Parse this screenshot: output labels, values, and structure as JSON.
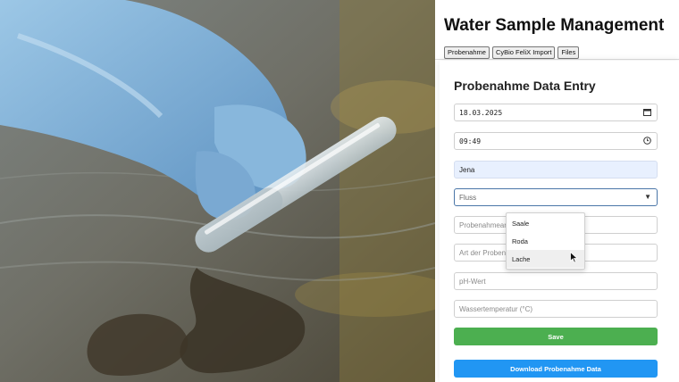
{
  "app": {
    "title": "Water Sample Management"
  },
  "tabs": [
    "Probenahme",
    "CyBio FeliX Import",
    "Files"
  ],
  "form": {
    "title": "Probenahme Data Entry",
    "date": {
      "value": "18.03.2025",
      "icon": "calendar-icon"
    },
    "time": {
      "value": "09:49",
      "icon": "clock-icon"
    },
    "location": {
      "value": "Jena"
    },
    "river": {
      "value": "Fluss",
      "icon": "caret-down-icon",
      "options": [
        "Saale",
        "Roda",
        "Lache"
      ],
      "hovered_option": "Lache"
    },
    "sampler": {
      "placeholder": "Probenahmear"
    },
    "sample_type": {
      "placeholder": "Art der Proben"
    },
    "ph": {
      "placeholder": "pH-Wert"
    },
    "water_temp": {
      "placeholder": "Wassertemperatur (°C)"
    },
    "save_label": "Save",
    "download_label": "Download Probenahme Data"
  },
  "colors": {
    "save": "#4caf50",
    "download": "#2196f3",
    "autofill": "#e8f0fe",
    "focus_border": "#4a76a8"
  }
}
